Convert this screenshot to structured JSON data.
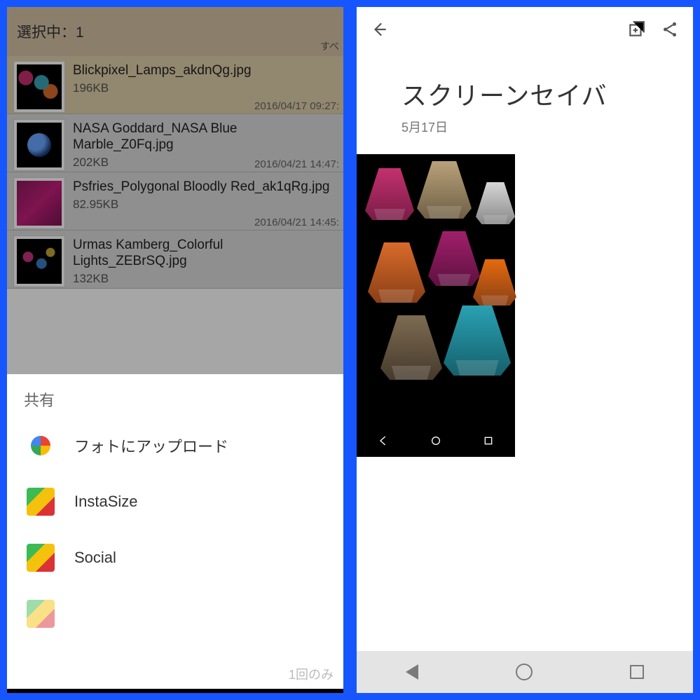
{
  "left": {
    "header_title": "選択中：1",
    "header_sub": "すべ",
    "files": [
      {
        "name": "Blickpixel_Lamps_akdnQg.jpg",
        "size": "196KB",
        "date": "2016/04/17 09:27:"
      },
      {
        "name": "NASA Goddard_NASA Blue Marble_Z0Fq.jpg",
        "size": "202KB",
        "date": "2016/04/21 14:47:"
      },
      {
        "name": "Psfries_Polygonal Bloodly Red_ak1qRg.jpg",
        "size": "82.95KB",
        "date": "2016/04/21 14:45:"
      },
      {
        "name": "Urmas Kamberg_Colorful Lights_ZEBrSQ.jpg",
        "size": "132KB",
        "date": ""
      }
    ],
    "share": {
      "title": "共有",
      "items": [
        {
          "label": "フォトにアップロード"
        },
        {
          "label": "InstaSize"
        },
        {
          "label": "Social"
        }
      ],
      "footer": "1回のみ"
    }
  },
  "right": {
    "title": "スクリーンセイバ",
    "date": "5月17日"
  }
}
